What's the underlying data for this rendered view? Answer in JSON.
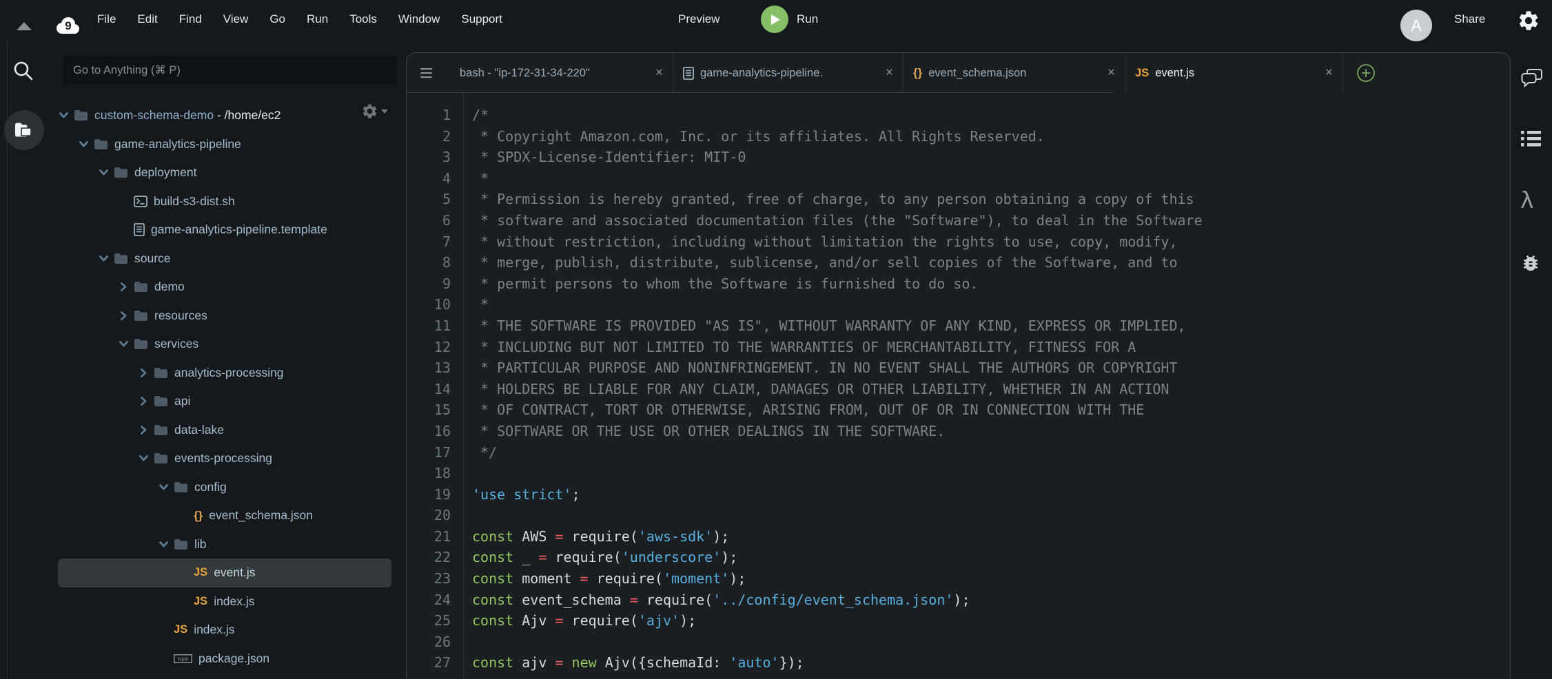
{
  "colors": {
    "bg": "#16191b",
    "editor-bg": "#1b1f21",
    "border": "#3e4347",
    "accent-green": "#84bf68",
    "js-badge": "#e8a33d",
    "keyword": "#94c75f",
    "operator": "#ef5b62",
    "string": "#57aedf",
    "comment": "#7b8287"
  },
  "menu_bar": {
    "items": [
      "File",
      "Edit",
      "Find",
      "View",
      "Go",
      "Run",
      "Tools",
      "Window",
      "Support"
    ],
    "preview_label": "Preview",
    "run_label": "Run",
    "avatar_letter": "A",
    "share_label": "Share"
  },
  "sidebar": {
    "goto_placeholder": "Go to Anything (⌘ P)",
    "tree": [
      {
        "label": "custom-schema-demo",
        "suffix": " - /home/ec2",
        "type": "folder",
        "state": "open",
        "level": 0
      },
      {
        "label": "game-analytics-pipeline",
        "type": "folder",
        "state": "open",
        "level": 1
      },
      {
        "label": "deployment",
        "type": "folder",
        "state": "open",
        "level": 2
      },
      {
        "label": "build-s3-dist.sh",
        "type": "shell",
        "level": 3
      },
      {
        "label": "game-analytics-pipeline.template",
        "type": "template",
        "level": 3
      },
      {
        "label": "source",
        "type": "folder",
        "state": "open",
        "level": 2
      },
      {
        "label": "demo",
        "type": "folder",
        "state": "closed",
        "level": 3
      },
      {
        "label": "resources",
        "type": "folder",
        "state": "closed",
        "level": 3
      },
      {
        "label": "services",
        "type": "folder",
        "state": "open",
        "level": 3
      },
      {
        "label": "analytics-processing",
        "type": "folder",
        "state": "closed",
        "level": 4
      },
      {
        "label": "api",
        "type": "folder",
        "state": "closed",
        "level": 4
      },
      {
        "label": "data-lake",
        "type": "folder",
        "state": "closed",
        "level": 4
      },
      {
        "label": "events-processing",
        "type": "folder",
        "state": "open",
        "level": 4
      },
      {
        "label": "config",
        "type": "folder",
        "state": "open",
        "level": 5
      },
      {
        "label": "event_schema.json",
        "type": "json",
        "level": 6
      },
      {
        "label": "lib",
        "type": "folder",
        "state": "open",
        "level": 5
      },
      {
        "label": "event.js",
        "type": "js",
        "level": 6,
        "selected": true
      },
      {
        "label": "index.js",
        "type": "js",
        "level": 6
      },
      {
        "label": "index.js",
        "type": "js",
        "level": 5
      },
      {
        "label": "package.json",
        "type": "npm",
        "level": 5
      }
    ]
  },
  "tabs": [
    {
      "icon": "none",
      "label": "bash - \"ip-172-31-34-220\"",
      "close": "×"
    },
    {
      "icon": "template",
      "label": "game-analytics-pipeline.",
      "close": "×"
    },
    {
      "icon": "json",
      "label": "event_schema.json",
      "close": "×"
    },
    {
      "icon": "js",
      "label": "event.js",
      "close": "×",
      "active": true
    }
  ],
  "editor": {
    "lines": [
      {
        "n": 1,
        "segs": [
          [
            "c",
            "/*"
          ]
        ]
      },
      {
        "n": 2,
        "segs": [
          [
            "c",
            " * Copyright Amazon.com, Inc. or its affiliates. All Rights Reserved."
          ]
        ]
      },
      {
        "n": 3,
        "segs": [
          [
            "c",
            " * SPDX-License-Identifier: MIT-0"
          ]
        ]
      },
      {
        "n": 4,
        "segs": [
          [
            "c",
            " *"
          ]
        ]
      },
      {
        "n": 5,
        "segs": [
          [
            "c",
            " * Permission is hereby granted, free of charge, to any person obtaining a copy of this"
          ]
        ]
      },
      {
        "n": 6,
        "segs": [
          [
            "c",
            " * software and associated documentation files (the \"Software\"), to deal in the Software"
          ]
        ]
      },
      {
        "n": 7,
        "segs": [
          [
            "c",
            " * without restriction, including without limitation the rights to use, copy, modify,"
          ]
        ]
      },
      {
        "n": 8,
        "segs": [
          [
            "c",
            " * merge, publish, distribute, sublicense, and/or sell copies of the Software, and to"
          ]
        ]
      },
      {
        "n": 9,
        "segs": [
          [
            "c",
            " * permit persons to whom the Software is furnished to do so."
          ]
        ]
      },
      {
        "n": 10,
        "segs": [
          [
            "c",
            " *"
          ]
        ]
      },
      {
        "n": 11,
        "segs": [
          [
            "c",
            " * THE SOFTWARE IS PROVIDED \"AS IS\", WITHOUT WARRANTY OF ANY KIND, EXPRESS OR IMPLIED,"
          ]
        ]
      },
      {
        "n": 12,
        "segs": [
          [
            "c",
            " * INCLUDING BUT NOT LIMITED TO THE WARRANTIES OF MERCHANTABILITY, FITNESS FOR A"
          ]
        ]
      },
      {
        "n": 13,
        "segs": [
          [
            "c",
            " * PARTICULAR PURPOSE AND NONINFRINGEMENT. IN NO EVENT SHALL THE AUTHORS OR COPYRIGHT"
          ]
        ]
      },
      {
        "n": 14,
        "segs": [
          [
            "c",
            " * HOLDERS BE LIABLE FOR ANY CLAIM, DAMAGES OR OTHER LIABILITY, WHETHER IN AN ACTION"
          ]
        ]
      },
      {
        "n": 15,
        "segs": [
          [
            "c",
            " * OF CONTRACT, TORT OR OTHERWISE, ARISING FROM, OUT OF OR IN CONNECTION WITH THE"
          ]
        ]
      },
      {
        "n": 16,
        "segs": [
          [
            "c",
            " * SOFTWARE OR THE USE OR OTHER DEALINGS IN THE SOFTWARE."
          ]
        ]
      },
      {
        "n": 17,
        "segs": [
          [
            "c",
            " */"
          ]
        ]
      },
      {
        "n": 18,
        "segs": []
      },
      {
        "n": 19,
        "segs": [
          [
            "s",
            "'use strict'"
          ],
          [
            "t",
            ";"
          ]
        ]
      },
      {
        "n": 20,
        "segs": []
      },
      {
        "n": 21,
        "segs": [
          [
            "k",
            "const"
          ],
          [
            "t",
            " AWS "
          ],
          [
            "o",
            "="
          ],
          [
            "t",
            " require("
          ],
          [
            "s",
            "'aws-sdk'"
          ],
          [
            "t",
            ");"
          ]
        ]
      },
      {
        "n": 22,
        "segs": [
          [
            "k",
            "const"
          ],
          [
            "t",
            " _ "
          ],
          [
            "o",
            "="
          ],
          [
            "t",
            " require("
          ],
          [
            "s",
            "'underscore'"
          ],
          [
            "t",
            ");"
          ]
        ]
      },
      {
        "n": 23,
        "segs": [
          [
            "k",
            "const"
          ],
          [
            "t",
            " moment "
          ],
          [
            "o",
            "="
          ],
          [
            "t",
            " require("
          ],
          [
            "s",
            "'moment'"
          ],
          [
            "t",
            ");"
          ]
        ]
      },
      {
        "n": 24,
        "segs": [
          [
            "k",
            "const"
          ],
          [
            "t",
            " event_schema "
          ],
          [
            "o",
            "="
          ],
          [
            "t",
            " require("
          ],
          [
            "s",
            "'../config/event_schema.json'"
          ],
          [
            "t",
            ");"
          ]
        ]
      },
      {
        "n": 25,
        "segs": [
          [
            "k",
            "const"
          ],
          [
            "t",
            " Ajv "
          ],
          [
            "o",
            "="
          ],
          [
            "t",
            " require("
          ],
          [
            "s",
            "'ajv'"
          ],
          [
            "t",
            ");"
          ]
        ]
      },
      {
        "n": 26,
        "segs": []
      },
      {
        "n": 27,
        "segs": [
          [
            "k",
            "const"
          ],
          [
            "t",
            " ajv "
          ],
          [
            "o",
            "="
          ],
          [
            "t",
            " "
          ],
          [
            "k",
            "new"
          ],
          [
            "t",
            " Ajv({schemaId: "
          ],
          [
            "s",
            "'auto'"
          ],
          [
            "t",
            "});"
          ]
        ]
      }
    ]
  },
  "right_rail": {
    "icons": [
      "collaboration",
      "outline",
      "aws-resources",
      "debug"
    ]
  }
}
